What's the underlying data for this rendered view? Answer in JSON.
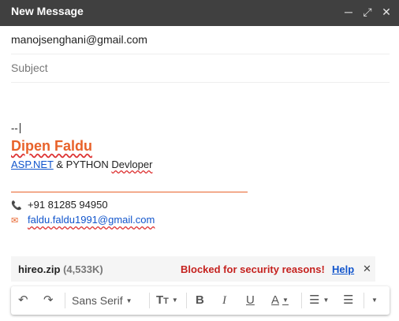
{
  "window": {
    "title": "New Message"
  },
  "compose": {
    "to": "manojsenghani@gmail.com",
    "subject_placeholder": "Subject"
  },
  "signature": {
    "dashes": "--",
    "name": "Dipen Faldu",
    "role_link": "ASP.NET",
    "role_mid": " & PYTHON ",
    "role_end": "Devloper",
    "phone": "+91 81285 94950",
    "email": "faldu.faldu1991@gmail.com"
  },
  "attachment": {
    "name": "hireo.zip",
    "size": "(4,533K)",
    "blocked_text": "Blocked for security reasons!",
    "help_label": "Help"
  },
  "toolbar": {
    "font": "Sans Serif"
  },
  "colors": {
    "accent": "#e8622a",
    "link": "#1155cc",
    "error": "#c5221f",
    "titlebar": "#404040"
  }
}
